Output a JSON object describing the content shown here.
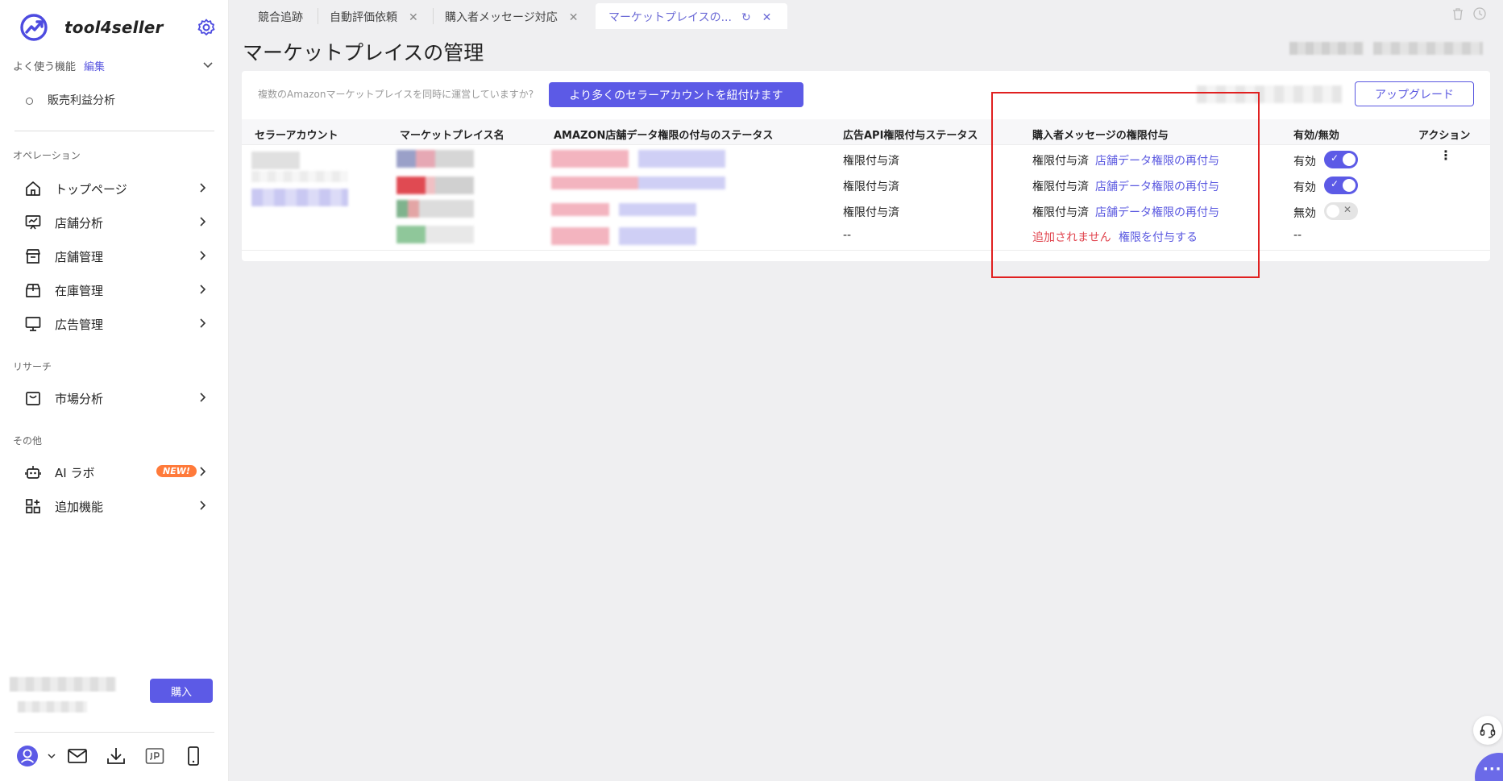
{
  "app": {
    "name": "tool4seller",
    "brand_color": "#5c5ae6"
  },
  "sidebar": {
    "favorites_label": "よく使う機能",
    "favorites_edit": "編集",
    "favorite_items": [
      "販売利益分析"
    ],
    "sections": [
      {
        "title": "オペレーション",
        "items": [
          "トップページ",
          "店舗分析",
          "店舗管理",
          "在庫管理",
          "広告管理"
        ]
      },
      {
        "title": "リサーチ",
        "items": [
          "市場分析"
        ]
      },
      {
        "title": "その他",
        "items": [
          "AI ラボ",
          "追加機能"
        ]
      }
    ],
    "new_badge": "NEW!",
    "buy_label": "購入"
  },
  "tabs": [
    {
      "label": "競合追跡"
    },
    {
      "label": "自動評価依頼"
    },
    {
      "label": "購入者メッセージ対応"
    },
    {
      "label": "マーケットプレイスの..."
    }
  ],
  "page": {
    "title": "マーケットプレイスの管理",
    "hint": "複数のAmazonマーケットプレイスを同時に運営していますか?",
    "link_button": "より多くのセラーアカウントを紐付けます",
    "upgrade_button": "アップグレード"
  },
  "table": {
    "headers": [
      "セラーアカウント",
      "マーケットプレイス名",
      "AMAZON店舗データ権限の付与のステータス",
      "広告API権限付与ステータス",
      "購入者メッセージの権限付与",
      "有効/無効",
      "アクション"
    ],
    "rows": [
      {
        "ad_api": "権限付与済",
        "msg_status": "権限付与済",
        "msg_action": "店舗データ権限の再付与",
        "enabled_label": "有効",
        "enabled": true
      },
      {
        "ad_api": "権限付与済",
        "msg_status": "権限付与済",
        "msg_action": "店舗データ権限の再付与",
        "enabled_label": "有効",
        "enabled": true
      },
      {
        "ad_api": "権限付与済",
        "msg_status": "権限付与済",
        "msg_action": "店舗データ権限の再付与",
        "enabled_label": "無効",
        "enabled": false
      },
      {
        "ad_api": "--",
        "msg_status": "追加されません",
        "msg_action": "権限を付与する",
        "enabled_label": "--",
        "enabled": null
      }
    ]
  }
}
